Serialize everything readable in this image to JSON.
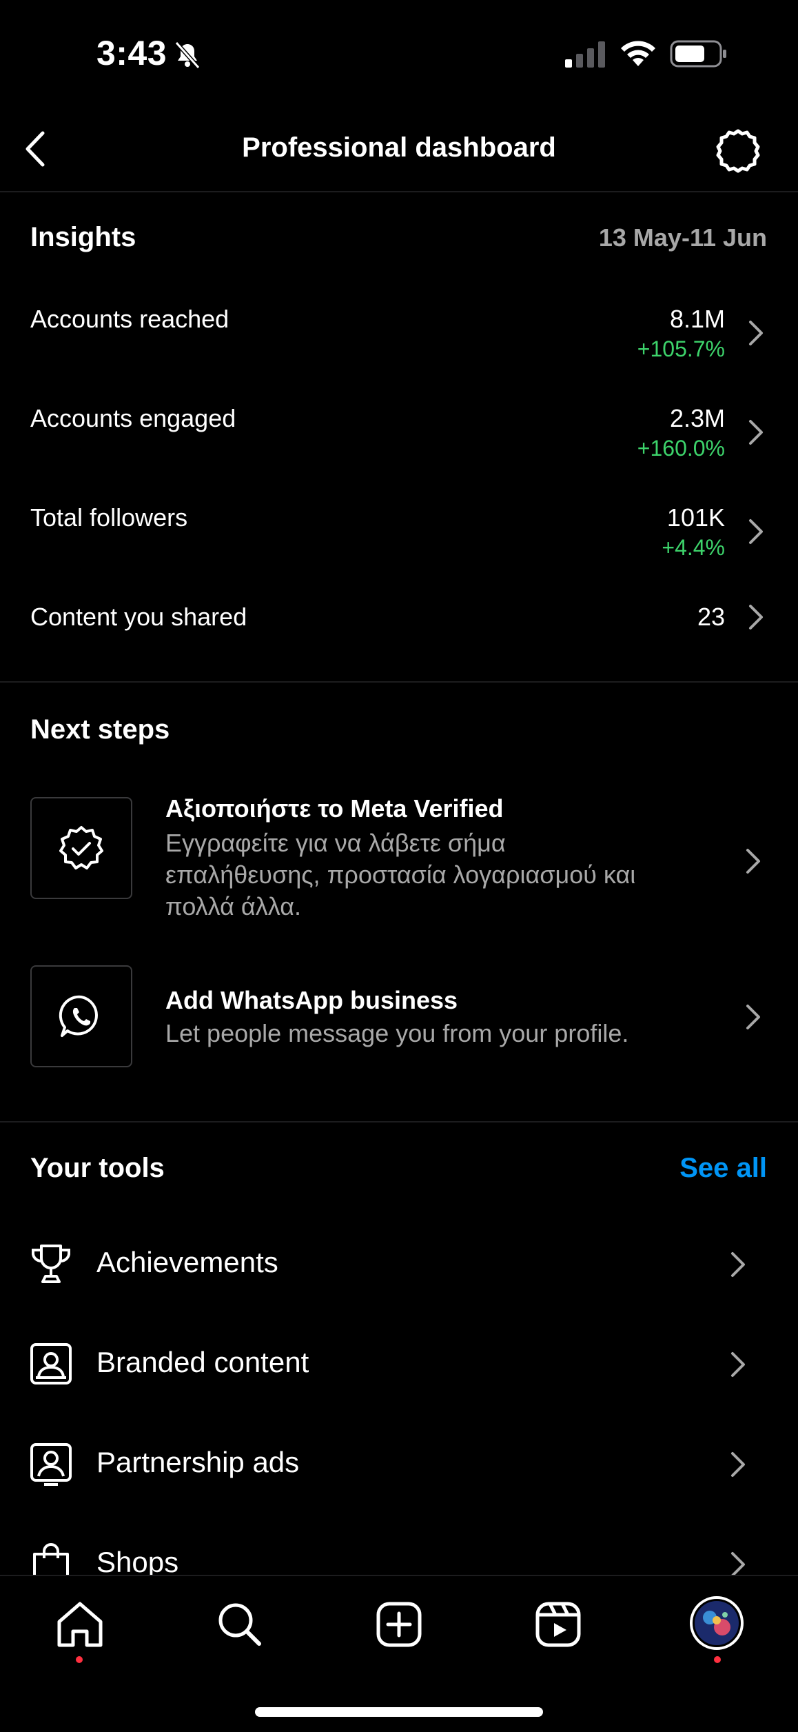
{
  "status_bar": {
    "time": "3:43",
    "icons": [
      "bell-slash-icon",
      "signal-icon",
      "wifi-icon",
      "battery-icon"
    ]
  },
  "header": {
    "title": "Professional dashboard",
    "back_icon": "chevron-left-icon",
    "settings_icon": "settings-gear-icon"
  },
  "insights": {
    "title": "Insights",
    "date_range": "13 May-11 Jun",
    "metrics": [
      {
        "label": "Accounts reached",
        "value": "8.1M",
        "change": "+105.7%"
      },
      {
        "label": "Accounts engaged",
        "value": "2.3M",
        "change": "+160.0%"
      },
      {
        "label": "Total followers",
        "value": "101K",
        "change": "+4.4%"
      },
      {
        "label": "Content you shared",
        "value": "23",
        "change": ""
      }
    ]
  },
  "next_steps": {
    "title": "Next steps",
    "items": [
      {
        "title": "Αξιοποιήστε το Meta Verified",
        "desc_lines": [
          "Εγγραφείτε για να λάβετε σήμα",
          "επαλήθευσης, προστασία λογαριασμού και",
          "πολλά άλλα."
        ],
        "icon": "verified-badge-icon"
      },
      {
        "title": "Add WhatsApp business",
        "desc_lines": [
          "Let people message you from your profile."
        ],
        "icon": "whatsapp-icon"
      }
    ]
  },
  "tools": {
    "title": "Your tools",
    "see_all": "See all",
    "items": [
      {
        "label": "Achievements",
        "icon": "trophy-icon"
      },
      {
        "label": "Branded content",
        "icon": "branded-content-icon"
      },
      {
        "label": "Partnership ads",
        "icon": "partnership-ads-icon"
      },
      {
        "label": "Shops",
        "icon": "shopping-bag-icon"
      }
    ]
  },
  "bottom_nav": {
    "items": [
      "home-icon",
      "search-icon",
      "create-icon",
      "reels-icon",
      "profile-avatar"
    ]
  },
  "colors": {
    "background": "#000000",
    "positive_change": "#3dd36b",
    "link_blue": "#0095f6",
    "secondary_text": "#a8a8a8",
    "notification_dot": "#ff3040"
  }
}
